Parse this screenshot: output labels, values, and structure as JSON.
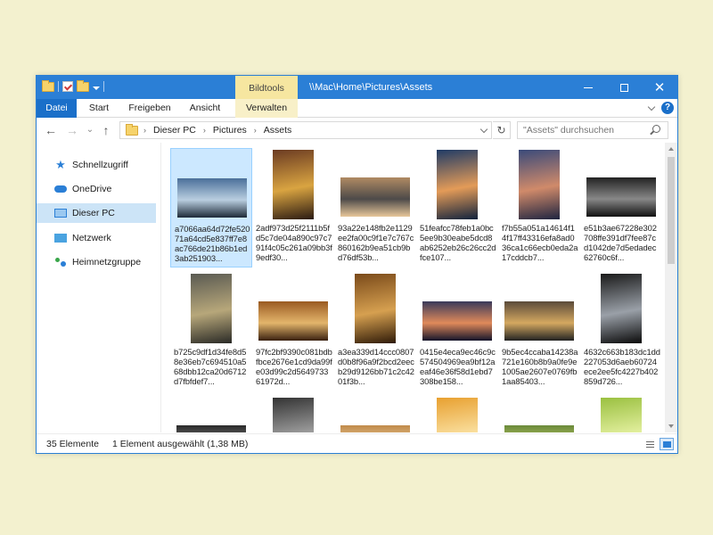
{
  "titlebar": {
    "contextual_tab": "Bildtools",
    "path": "\\\\Mac\\Home\\Pictures\\Assets",
    "close_glyph": "✕"
  },
  "ribbon": {
    "tabs": [
      {
        "label": "Datei",
        "active": true
      },
      {
        "label": "Start"
      },
      {
        "label": "Freigeben"
      },
      {
        "label": "Ansicht"
      },
      {
        "label": "Verwalten",
        "contextual": true
      }
    ]
  },
  "nav": {
    "back": "←",
    "forward": "→",
    "recent": "⌄",
    "up": "↑",
    "refresh": "↻"
  },
  "address": {
    "crumbs": [
      "Dieser PC",
      "Pictures",
      "Assets"
    ],
    "separator": "›"
  },
  "search": {
    "placeholder": "\"Assets\" durchsuchen"
  },
  "sidebar": {
    "items": [
      {
        "label": "Schnellzugriff",
        "icon": "star-icon"
      },
      {
        "label": "OneDrive",
        "icon": "cloud-icon"
      },
      {
        "label": "Dieser PC",
        "icon": "computer-icon",
        "selected": true
      },
      {
        "label": "Netzwerk",
        "icon": "network-icon"
      },
      {
        "label": "Heimnetzgruppe",
        "icon": "homegroup-icon"
      }
    ]
  },
  "files": [
    {
      "name": "a7066aa64d72fe52071a64cd5e837ff7e8ac766de21b86b1ed3ab251903...",
      "colors": [
        "#4a6f9a",
        "#b9cee0",
        "#1d2a38"
      ],
      "orientation": "landscape",
      "selected": true
    },
    {
      "name": "2adf973d25f2111b5fd5c7de04a890c97c791f4c05c261a09bb3f9edf30...",
      "colors": [
        "#6b3b22",
        "#d9a441",
        "#2a1a12"
      ],
      "orientation": "portrait"
    },
    {
      "name": "93a22e148fb2e1129ee2fa00c9f1e7c767c860162b9ea51cb9bd76df53b...",
      "colors": [
        "#b08a63",
        "#4d4a49",
        "#e7c79a"
      ],
      "orientation": "landscape"
    },
    {
      "name": "51feafcc78feb1a0bc5ee9b30eabe5dcd8ab6252eb26c26cc2dfce107...",
      "colors": [
        "#1f3b66",
        "#e39b58",
        "#10223d"
      ],
      "orientation": "portrait"
    },
    {
      "name": "f7b55a051a14614f14f17ff43316efa8ad036ca1c66ecb0eda2a17cddcb7...",
      "colors": [
        "#3a4a7a",
        "#d08a6a",
        "#1e2440"
      ],
      "orientation": "portrait"
    },
    {
      "name": "e51b3ae67228e302708ffe391df7fee87cd1042de7d5edadec62760c6f...",
      "colors": [
        "#222222",
        "#888888",
        "#111111"
      ],
      "orientation": "landscape"
    },
    {
      "name": "b725c9df1d34fe8d58e36eb7c694510a568dbb12ca20d6712d7fbfdef7...",
      "colors": [
        "#5a5a52",
        "#b7a77a",
        "#2a2a26"
      ],
      "orientation": "portrait"
    },
    {
      "name": "97fc2bf9390c081bdbfbce2676e1cd9da99fe03d99c2d564973361972d...",
      "colors": [
        "#9a5a22",
        "#e3b56b",
        "#3a2010"
      ],
      "orientation": "landscape"
    },
    {
      "name": "a3ea339d14ccc0807d0b8f96a9f2bcd2eecb29d9126bb71c2c4201f3b...",
      "colors": [
        "#7a4a1a",
        "#d6a050",
        "#2e1a08"
      ],
      "orientation": "portrait"
    },
    {
      "name": "0415e4eca9ec46c9c574504969ea9bf12aeaf46e36f58d1ebd7308be158...",
      "colors": [
        "#3a3a5a",
        "#e08a5a",
        "#14142a"
      ],
      "orientation": "landscape"
    },
    {
      "name": "9b5ec4ccaba14238a721e160b8b9a0fe9e1005ae2607e0769fb1aa85403...",
      "colors": [
        "#5a4a3a",
        "#d4a860",
        "#222222"
      ],
      "orientation": "landscape"
    },
    {
      "name": "4632c663b183dc1dd227053d6aeb60724ece2ee5fc4227b402859d726...",
      "colors": [
        "#1a1a1a",
        "#9aa0a8",
        "#0a0a0a"
      ],
      "orientation": "portrait"
    },
    {
      "name": "",
      "colors": [
        "#2a2a2a",
        "#888888",
        "#111111"
      ],
      "orientation": "landscape"
    },
    {
      "name": "",
      "colors": [
        "#333333",
        "#a0a0a0",
        "#1a1a1a"
      ],
      "orientation": "portrait"
    },
    {
      "name": "",
      "colors": [
        "#c08a4a",
        "#f2d8a8",
        "#a06a30"
      ],
      "orientation": "landscape"
    },
    {
      "name": "",
      "colors": [
        "#e8a030",
        "#fae0a0",
        "#8a5a10"
      ],
      "orientation": "portrait"
    },
    {
      "name": "",
      "colors": [
        "#6a8a3a",
        "#c8d070",
        "#3a5a1a"
      ],
      "orientation": "landscape"
    },
    {
      "name": "",
      "colors": [
        "#9ac040",
        "#e4f0a0",
        "#5a8a20"
      ],
      "orientation": "portrait"
    }
  ],
  "status": {
    "count": "35 Elemente",
    "selection": "1 Element ausgewählt (1,38 MB)"
  },
  "colors": {
    "accent": "#2b7fd6",
    "selection": "#cce8ff",
    "contextual_tab": "#f6e6a0"
  }
}
